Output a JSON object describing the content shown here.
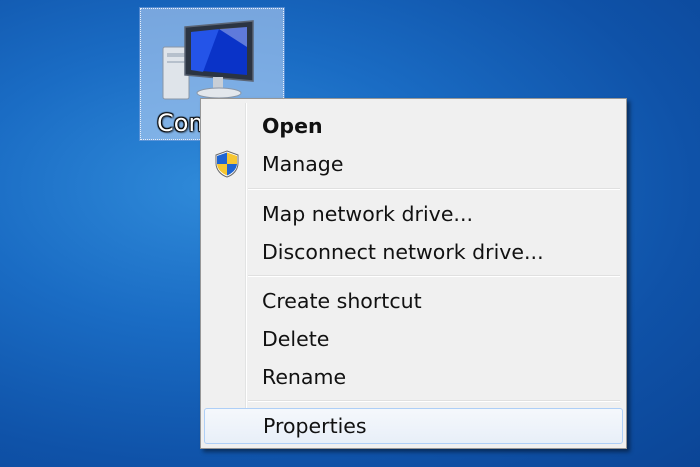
{
  "desktop": {
    "background_color": "#1a6cc4",
    "icon": {
      "label": "Computer",
      "icon_name": "computer-icon"
    }
  },
  "context_menu": {
    "items": [
      {
        "label": "Open",
        "bold": true
      },
      {
        "label": "Manage",
        "icon": "uac-shield-icon"
      },
      {
        "label": "Map network drive..."
      },
      {
        "label": "Disconnect network drive..."
      },
      {
        "label": "Create shortcut"
      },
      {
        "label": "Delete"
      },
      {
        "label": "Rename"
      },
      {
        "label": "Properties",
        "highlighted": true
      }
    ],
    "colors": {
      "background": "#f0f0f0",
      "highlight_border": "#aecff7"
    }
  }
}
